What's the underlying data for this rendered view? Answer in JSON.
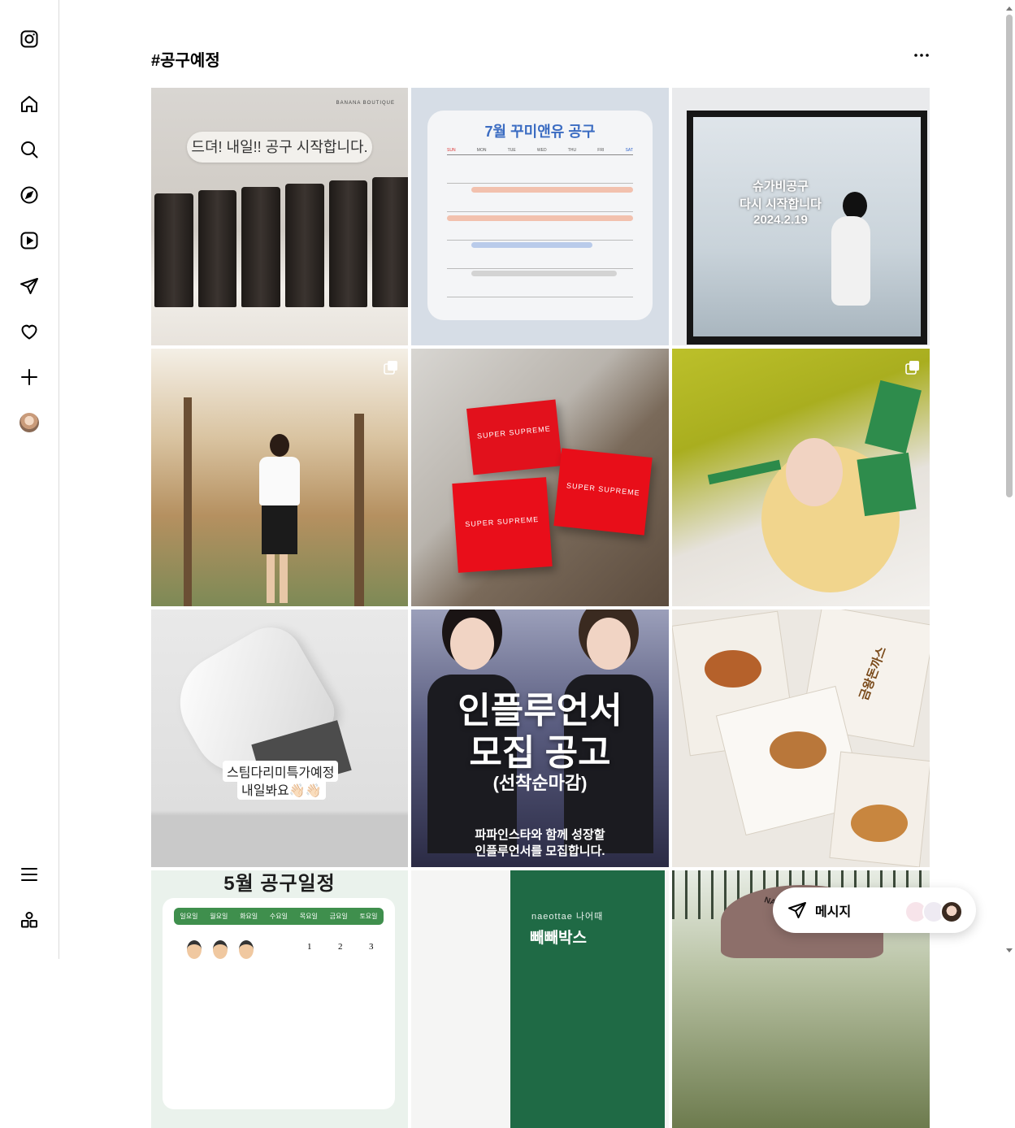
{
  "hashtag": "#공구예정",
  "nav": {
    "icons": [
      "instagram-icon",
      "home-icon",
      "search-icon",
      "explore-icon",
      "reels-icon",
      "messages-icon",
      "notifications-icon",
      "create-icon",
      "profile-avatar"
    ],
    "bottom": [
      "menu-icon",
      "apps-icon"
    ]
  },
  "posts": [
    {
      "caption": "드뎌! 내일!! 공구 시작합니다.",
      "brand": "BANANA BOUTIQUE"
    },
    {
      "title": "7월 꾸미앤유 공구",
      "days": [
        "SUN",
        "MON",
        "TUE",
        "WED",
        "THU",
        "FRI",
        "SAT"
      ]
    },
    {
      "caption1": "슈가비공구",
      "caption2": "다시 시작합니다",
      "caption3": "2024.2.19"
    },
    {
      "multi": true
    },
    {
      "brand": "SUPER SUPREME",
      "brand_small": "SUPER"
    },
    {
      "multi": true
    },
    {
      "caption1": "스팀다리미특가예정",
      "caption2": "내일봐요👋🏻👋🏻"
    },
    {
      "caption1": "인플루언서",
      "caption2": "모집 공고",
      "caption3": "(선착순마감)",
      "caption4": "파파인스타와 함께 성장할",
      "caption5": "인플루언서를 모집합니다."
    },
    {
      "label": "금왕돈까스"
    },
    {
      "title": "5월 공구일정",
      "days": [
        "일요일",
        "월요일",
        "화요일",
        "수요일",
        "목요일",
        "금요일",
        "토요일"
      ],
      "nums": [
        "1",
        "2",
        "3"
      ]
    },
    {
      "brand": "naeottae 나어때",
      "name": "빼빼박스"
    },
    {
      "brand": "NATURE"
    }
  ],
  "message_button": {
    "label": "메시지"
  },
  "colors": {
    "border": "#dbdbdb",
    "accent": "#0095f6"
  }
}
